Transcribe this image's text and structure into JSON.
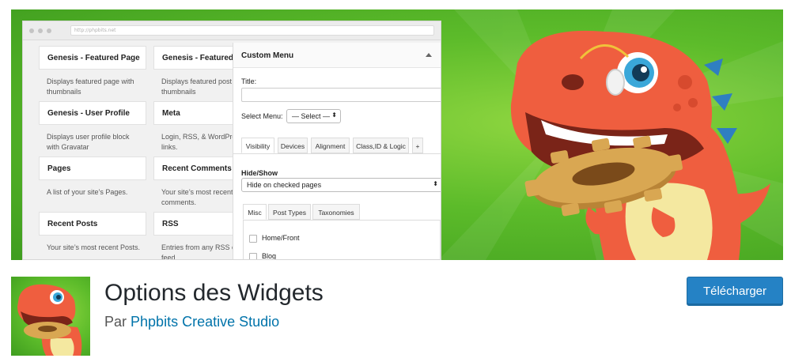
{
  "browser": {
    "url": "http://phpbits.net"
  },
  "widgets": [
    {
      "name": "Genesis - Featured Page",
      "desc_lines": [
        "Displays featured page with",
        "thumbnails"
      ]
    },
    {
      "name": "Genesis - Featured P",
      "desc_lines": [
        "Displays featured post",
        "thumbnails"
      ]
    },
    {
      "name": "Genesis - User Profile",
      "desc_lines": [
        "Displays user profile block",
        "with Gravatar"
      ]
    },
    {
      "name": "Meta",
      "desc_lines": [
        "Login, RSS, & WordPres",
        "links."
      ]
    },
    {
      "name": "Pages",
      "desc_lines": [
        "A list of your site’s Pages."
      ]
    },
    {
      "name": "Recent Comments",
      "desc_lines": [
        "Your site’s most recent",
        "comments."
      ]
    },
    {
      "name": "Recent Posts",
      "desc_lines": [
        "Your site’s most recent Posts."
      ]
    },
    {
      "name": "RSS",
      "desc_lines": [
        "Entries from any RSS o",
        "feed."
      ]
    }
  ],
  "panel": {
    "header": "Custom Menu",
    "title_label": "Title:",
    "title_value": "",
    "select_menu_label": "Select Menu:",
    "select_menu_value": "— Select —",
    "tabs": [
      "Visibility",
      "Devices",
      "Alignment",
      "Class,ID & Logic",
      "+"
    ],
    "hide_show_label": "Hide/Show",
    "hide_show_value": "Hide on checked pages",
    "subtabs": [
      "Misc",
      "Post Types",
      "Taxonomies"
    ],
    "checks": [
      "Home/Front",
      "Blog"
    ]
  },
  "plugin": {
    "name": "Options des Widgets",
    "by_prefix": "Par",
    "author": "Phpbits Creative Studio",
    "download_label": "Télécharger"
  },
  "colors": {
    "banner_green": "#5cbb2a",
    "dino_orange": "#ef5e3f",
    "dino_belly": "#f4e8a0",
    "cog": "#d9a752",
    "button_blue": "#2582c5",
    "link_blue": "#0073aa"
  }
}
